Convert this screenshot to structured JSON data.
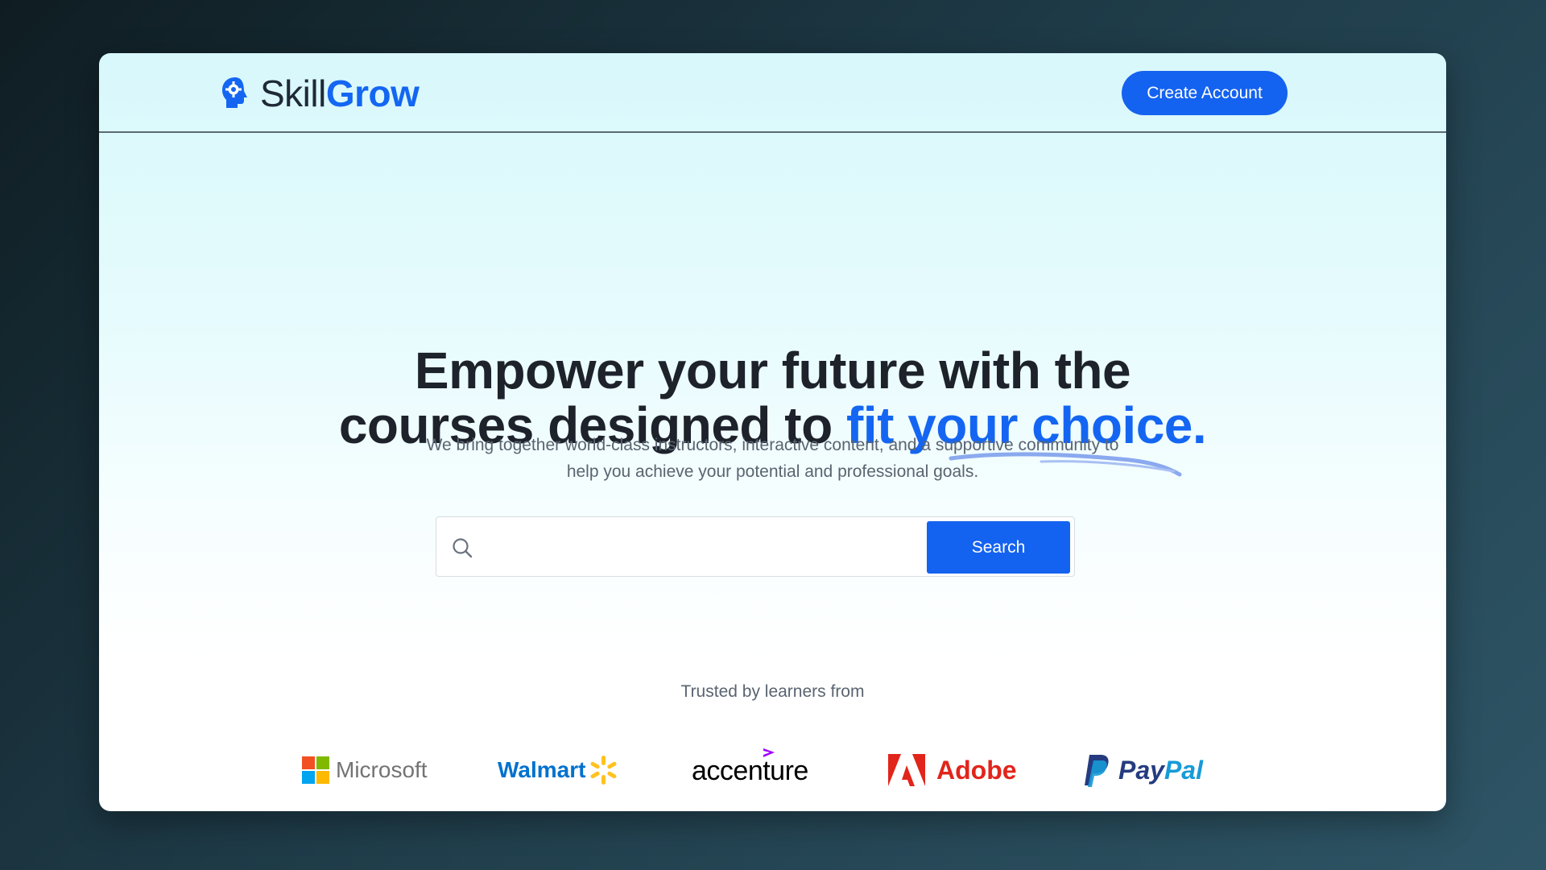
{
  "brand": {
    "name_part1": "Skill",
    "name_part2": "Grow",
    "logo_icon": "head-gear-icon",
    "accent_color": "#1466f2"
  },
  "header": {
    "cta_label": "Create Account"
  },
  "hero": {
    "headline_line1": "Empower your future with the",
    "headline_line2_plain": "courses designed to ",
    "headline_line2_accent": "fit your choice.",
    "subtitle_line1": "We bring together world-class instructors, interactive content, and a supportive community to",
    "subtitle_line2": "help you achieve your potential and professional goals."
  },
  "search": {
    "icon": "search-icon",
    "value": "",
    "placeholder": "",
    "button_label": "Search"
  },
  "trusted": {
    "heading": "Trusted by learners from",
    "companies": [
      {
        "name": "Microsoft",
        "icon": "microsoft-logo-icon"
      },
      {
        "name": "Walmart",
        "icon": "walmart-spark-icon"
      },
      {
        "name": "accenture",
        "icon": "accenture-chevron-icon"
      },
      {
        "name": "Adobe",
        "icon": "adobe-logo-icon"
      },
      {
        "name_part1": "Pay",
        "name_part2": "Pal",
        "icon": "paypal-logo-icon"
      }
    ]
  },
  "colors": {
    "primary": "#1462f0",
    "text_dark": "#1d222b",
    "text_muted": "#5a6470"
  }
}
